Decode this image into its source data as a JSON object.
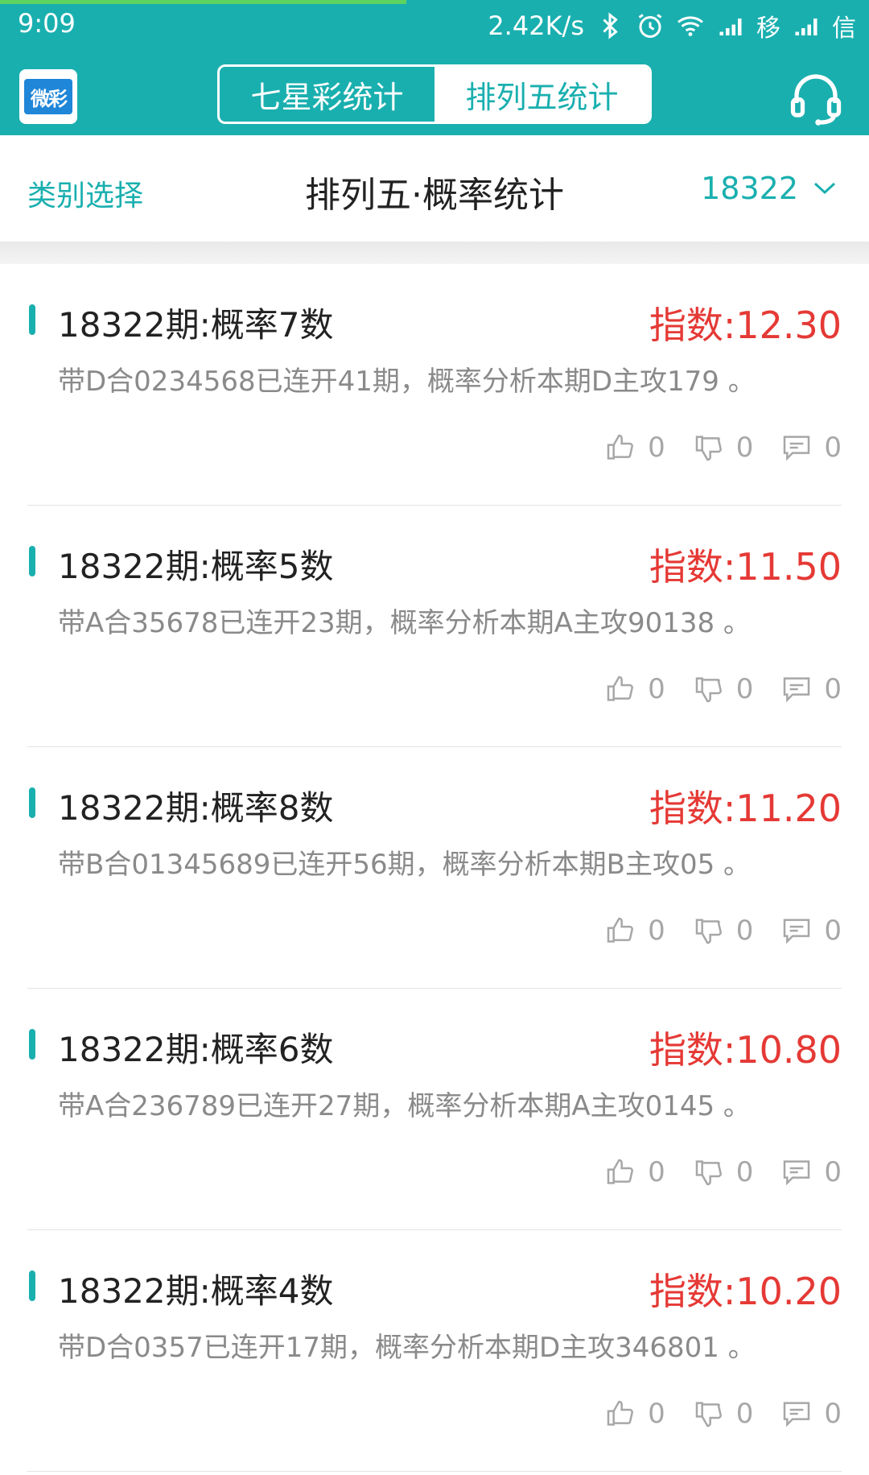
{
  "status": {
    "time": "9:09",
    "speed": "2.42K/s",
    "carrier1": "移",
    "carrier2": "信"
  },
  "header": {
    "logo_text": "微彩",
    "tabs": [
      {
        "label": "七星彩统计",
        "active": false
      },
      {
        "label": "排列五统计",
        "active": true
      }
    ]
  },
  "subheader": {
    "category_label": "类别选择",
    "title": "排列五·概率统计",
    "period": "18322"
  },
  "items": [
    {
      "title": "18322期:概率7数",
      "index": "指数:12.30",
      "desc": "带D合0234568已连开41期，概率分析本期D主攻179 。",
      "likes": "0",
      "dislikes": "0",
      "comments": "0"
    },
    {
      "title": "18322期:概率5数",
      "index": "指数:11.50",
      "desc": "带A合35678已连开23期，概率分析本期A主攻90138 。",
      "likes": "0",
      "dislikes": "0",
      "comments": "0"
    },
    {
      "title": "18322期:概率8数",
      "index": "指数:11.20",
      "desc": "带B合01345689已连开56期，概率分析本期B主攻05 。",
      "likes": "0",
      "dislikes": "0",
      "comments": "0"
    },
    {
      "title": "18322期:概率6数",
      "index": "指数:10.80",
      "desc": "带A合236789已连开27期，概率分析本期A主攻0145 。",
      "likes": "0",
      "dislikes": "0",
      "comments": "0"
    },
    {
      "title": "18322期:概率4数",
      "index": "指数:10.20",
      "desc": "带D合0357已连开17期，概率分析本期D主攻346801 。",
      "likes": "0",
      "dislikes": "0",
      "comments": "0"
    }
  ],
  "colors": {
    "accent": "#1aafaf",
    "index_red": "#e53935",
    "muted_text": "#8a8a8a"
  }
}
